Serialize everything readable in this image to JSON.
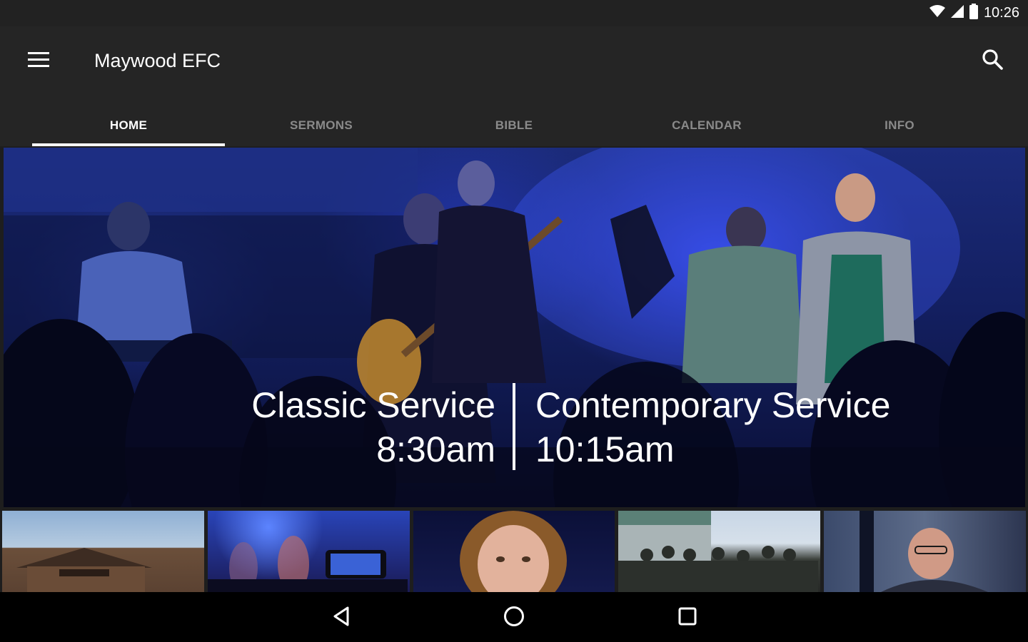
{
  "status_bar": {
    "time": "10:26",
    "icons": [
      "wifi-icon",
      "cell-signal-icon",
      "battery-icon"
    ]
  },
  "app_bar": {
    "title": "Maywood EFC",
    "menu_icon": "hamburger-menu-icon",
    "search_icon": "search-icon"
  },
  "tabs": [
    {
      "label": "HOME",
      "active": true
    },
    {
      "label": "SERMONS",
      "active": false
    },
    {
      "label": "BIBLE",
      "active": false
    },
    {
      "label": "CALENDAR",
      "active": false
    },
    {
      "label": "INFO",
      "active": false
    }
  ],
  "hero": {
    "left_line1": "Classic Service",
    "left_line2": "8:30am",
    "right_line1": "Contemporary Service",
    "right_line2": "10:15am"
  },
  "nav_bar": {
    "icons": [
      "back-icon",
      "home-icon",
      "recent-apps-icon"
    ]
  },
  "colors": {
    "app_bar": "#252525",
    "status_bar": "#222222",
    "active_tab": "#ffffff",
    "inactive_tab": "#8a8a8a",
    "hero_blue": "#1b2b7a"
  }
}
